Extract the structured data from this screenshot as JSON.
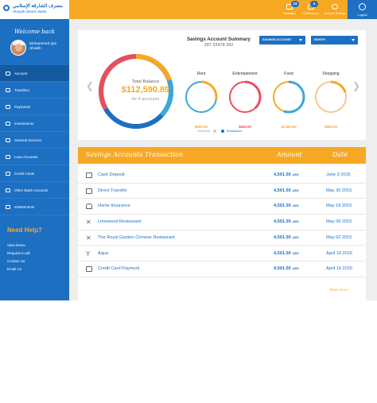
{
  "brand": {
    "logo_arabic": "مصرف الشارقة الإسلامي",
    "logo_english": "Sharjah Islamic Bank"
  },
  "topbar": {
    "items": [
      {
        "label": "Messages",
        "badge": "24",
        "icon": "envelope-icon"
      },
      {
        "label": "Notifications",
        "badge": "4",
        "icon": "bell-icon"
      },
      {
        "label": "Account Settings",
        "badge": "",
        "icon": "gear-icon"
      }
    ],
    "logout_label": "Logout"
  },
  "sidebar": {
    "welcome": "Welcome back",
    "user_name": "Mohammed Ijaz Shaikh",
    "items": [
      {
        "label": "Account",
        "active": true
      },
      {
        "label": "Transfers"
      },
      {
        "label": "Payments"
      },
      {
        "label": "Investments"
      },
      {
        "label": "General Services"
      },
      {
        "label": "Loan Accounts"
      },
      {
        "label": "Credit Cards"
      },
      {
        "label": "Other Bank Accounts"
      },
      {
        "label": "eStatements"
      }
    ],
    "help_title": "Need Help?",
    "help_links": [
      "View Demo",
      "Request a call",
      "Contact Us",
      "Email Us"
    ]
  },
  "summary": {
    "title": "Savings Account Summary",
    "account_number": "287 33478 282",
    "account_select": "SAVINGS ACCOUNT",
    "period_select": "MONTH",
    "total_balance_label": "Total Balance",
    "total_balance": "$112,590.89",
    "accounts_count": "for 4 accounts",
    "categories": [
      {
        "label": "Rent",
        "amount": "$500.00",
        "color": "#f7a823",
        "fraction": 0.28
      },
      {
        "label": "Entertainment",
        "amount": "$500.00",
        "color": "#e94e5b",
        "fraction": 0.38
      },
      {
        "label": "Food",
        "amount": "$1,500.00",
        "color": "#3aa8d8",
        "fraction": 0.55
      },
      {
        "label": "Shopping",
        "amount": "$500.00",
        "color": "#f7a823",
        "fraction": 0.2
      }
    ],
    "legend": {
      "overview": "Overview",
      "breakdown": "Breakdown"
    }
  },
  "transactions": {
    "headers": {
      "desc": "Savings Accounts Transaction",
      "amount": "Amount",
      "date": "Date"
    },
    "currency": "AED",
    "rows": [
      {
        "desc": "Cash Deposit",
        "amount": "4,501.50",
        "date": "June 3 2015",
        "icon": "cash-icon"
      },
      {
        "desc": "Direct Transfer",
        "amount": "4,501.50",
        "date": "May 30 2015",
        "icon": "transfer-icon"
      },
      {
        "desc": "Home Insurance",
        "amount": "4,501.50",
        "date": "May 19 2015",
        "icon": "home-icon"
      },
      {
        "desc": "Limewood Restaurant",
        "amount": "4,501.50",
        "date": "May 09 2015",
        "icon": "cutlery-icon"
      },
      {
        "desc": "The Royal Garden Chinese Restaurant",
        "amount": "4,501.50",
        "date": "May 02 2015",
        "icon": "cutlery-icon"
      },
      {
        "desc": "Aqua",
        "amount": "4,501.50",
        "date": "April 19 2015",
        "icon": "cocktail-icon"
      },
      {
        "desc": "Credit Card Payment",
        "amount": "4,501.50",
        "date": "April 16 2015",
        "icon": "credit-card-icon"
      }
    ],
    "show_more": "Show more"
  },
  "colors": {
    "accent": "#f7a823",
    "brand_blue": "#1d6fc2"
  }
}
